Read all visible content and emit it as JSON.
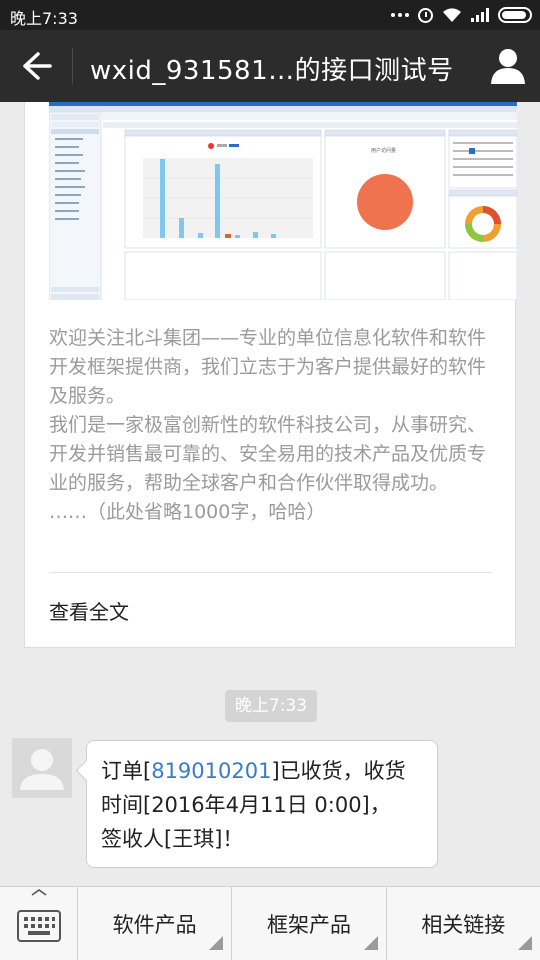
{
  "status_bar": {
    "time": "晚上7:33",
    "icons": [
      "more-dots-icon",
      "alarm-icon",
      "wifi-icon",
      "signal-icon",
      "battery-icon"
    ]
  },
  "header": {
    "title": "wxid_931581…的接口测试号",
    "back_icon": "arrow-left-icon",
    "profile_icon": "person-icon"
  },
  "article": {
    "image_caption": "用户访问量",
    "paragraphs": [
      "欢迎关注北斗集团——专业的单位信息化软件和软件开发框架提供商，我们立志于为客户提供最好的软件及服务。",
      "我们是一家极富创新性的软件科技公司，从事研究、开发并销售最可靠的、安全易用的技术产品及优质专业的服务，帮助全球客户和合作伙伴取得成功。",
      "……（此处省略1000字，哈哈）"
    ],
    "read_more": "查看全文"
  },
  "time_divider": "晚上7:33",
  "message": {
    "prefix": "订单[",
    "order_no": "819010201",
    "line1_suffix": "]已收货，收货",
    "line2": "时间[2016年4月11日 0:00]，",
    "line3": "签收人[王琪]！"
  },
  "bottom_menu": {
    "keyboard_icon": "keyboard-icon",
    "items": [
      {
        "label": "软件产品"
      },
      {
        "label": "框架产品"
      },
      {
        "label": "相关链接"
      }
    ]
  },
  "colors": {
    "title_bar": "#2c2c2c",
    "link": "#3a7bc8",
    "chat_bg": "#ebebeb"
  }
}
